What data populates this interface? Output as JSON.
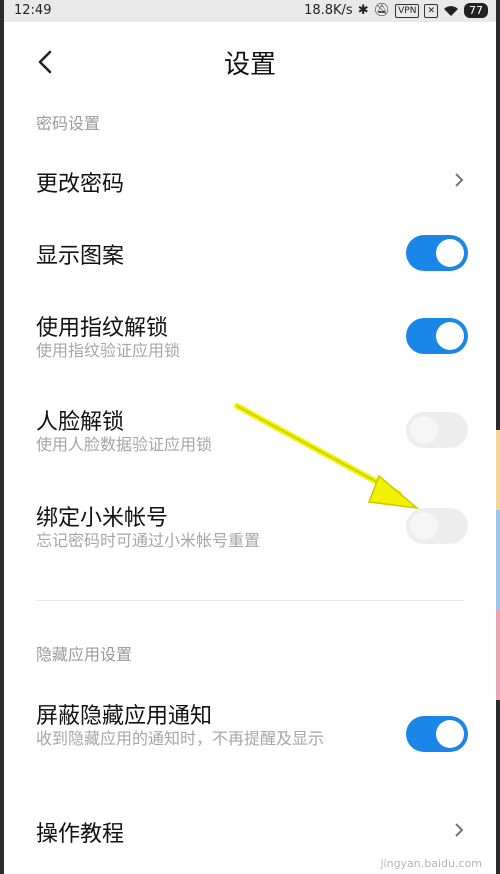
{
  "status": {
    "time": "12:49",
    "speed": "18.8K/s",
    "vpn": "VPN",
    "battery": "77"
  },
  "header": {
    "title": "设置"
  },
  "sections": [
    {
      "title": "密码设置",
      "items": [
        {
          "label": "更改密码",
          "type": "link"
        },
        {
          "label": "显示图案",
          "type": "toggle",
          "on": true
        },
        {
          "label": "使用指纹解锁",
          "sub": "使用指纹验证应用锁",
          "type": "toggle",
          "on": true
        },
        {
          "label": "人脸解锁",
          "sub": "使用人脸数据验证应用锁",
          "type": "toggle",
          "on": false
        },
        {
          "label": "绑定小米帐号",
          "sub": "忘记密码时可通过小米帐号重置",
          "type": "toggle",
          "on": false
        }
      ]
    },
    {
      "title": "隐藏应用设置",
      "items": [
        {
          "label": "屏蔽隐藏应用通知",
          "sub": "收到隐藏应用的通知时，不再提醒及显示",
          "type": "toggle",
          "on": true
        },
        {
          "label": "操作教程",
          "type": "link"
        }
      ]
    }
  ],
  "watermark": "jingyan.baidu.com",
  "colors": {
    "toggle_on": "#1a86e8",
    "toggle_off": "#ededed",
    "annotation_arrow": "#f2f200"
  }
}
